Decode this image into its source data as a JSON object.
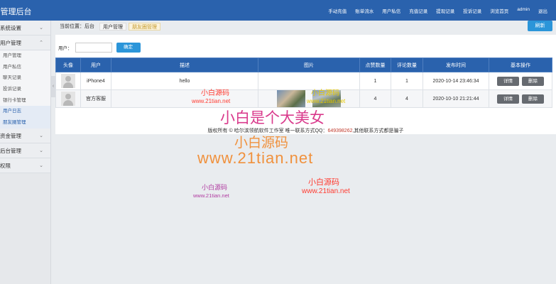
{
  "header": {
    "title": "i管理后台",
    "nav": [
      "手动充值",
      "账单流水",
      "用户私信",
      "充值记录",
      "提现记录",
      "投诉记录",
      "浏览首页",
      "admin",
      "退出"
    ]
  },
  "sidebar": {
    "sections": [
      {
        "label": "系统设置",
        "items": []
      },
      {
        "label": "用户管理",
        "items": [
          {
            "label": "用户管理",
            "active": false
          },
          {
            "label": "用户私信",
            "active": false
          },
          {
            "label": "聊天记录",
            "active": false
          },
          {
            "label": "投诉记录",
            "active": false
          },
          {
            "label": "银行卡管理",
            "active": false
          },
          {
            "label": "用户日志",
            "active": true
          },
          {
            "label": "朋友圈管理",
            "active": true
          }
        ]
      },
      {
        "label": "资金管理",
        "items": []
      },
      {
        "label": "后台管理",
        "items": []
      },
      {
        "label": "权限",
        "items": []
      }
    ]
  },
  "breadcrumb": {
    "prefix": "当前位置：后台",
    "parent": "用户管理",
    "current": "朋友圈管理"
  },
  "toolbar": {
    "refresh_label": "刷新"
  },
  "filter": {
    "user_label": "用户：",
    "user_value": "",
    "user_placeholder": "",
    "submit_label": "确定"
  },
  "table": {
    "headers": [
      "头像",
      "用户",
      "描述",
      "图片",
      "点赞数量",
      "评论数量",
      "发布时间",
      "基本操作"
    ],
    "rows": [
      {
        "user": "iPhone4",
        "description": "hello",
        "likes": "1",
        "comments": "1",
        "time": "2020-10-14 23:46:34",
        "has_images": false
      },
      {
        "user": "官方客服",
        "description": "",
        "likes": "4",
        "comments": "4",
        "time": "2020-10-10 21:21:44",
        "has_images": true
      }
    ],
    "detail_label": "详情",
    "delete_label": "删除"
  },
  "footer": {
    "prefix": "版权所有 © 哈尔滨领航软件工作室 唯一联系方式QQ：",
    "qq": "649398262",
    "suffix": ",其他联系方式都是骗子"
  },
  "watermarks": {
    "cn": "小白源码",
    "url": "www.21tian.net",
    "slogan": "小白是个大美女"
  },
  "colors": {
    "header": "#2a62ad",
    "accent_button": "#2b95d9",
    "action_button": "#666a70",
    "watermark_red": "#ff3b30",
    "watermark_orange": "#f0913d",
    "watermark_purple": "#b03aa0"
  }
}
